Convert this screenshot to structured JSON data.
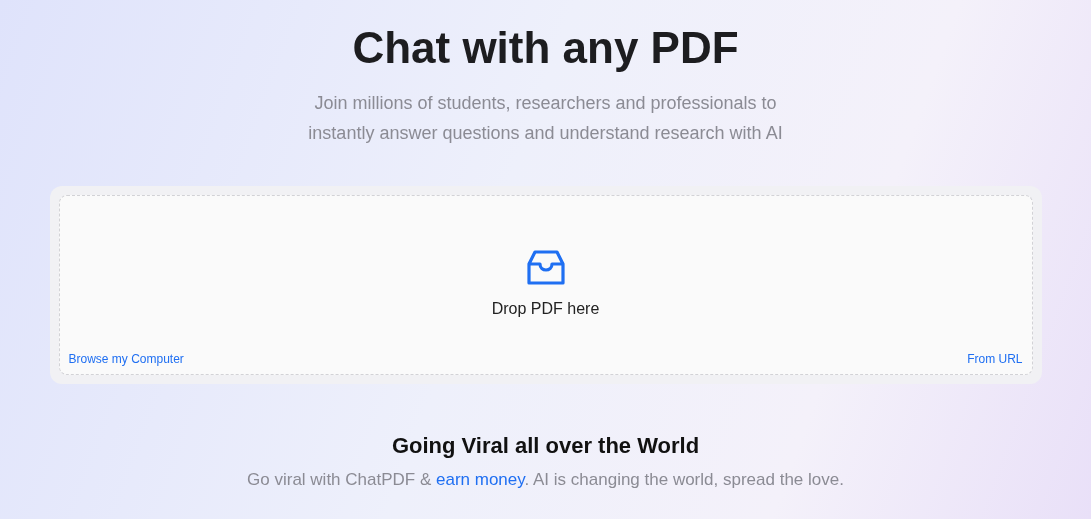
{
  "hero": {
    "title": "Chat with any PDF",
    "subtitle_lines": [
      "Join millions of students, researchers and professionals to",
      "instantly answer questions and understand research with AI"
    ]
  },
  "dropzone": {
    "label": "Drop PDF here",
    "browse_link": "Browse my Computer",
    "url_link": "From URL"
  },
  "viral": {
    "heading": "Going Viral all over the World",
    "text_before": "Go viral with ChatPDF & ",
    "link": "earn money",
    "text_after": ". AI is changing the world, spread the love."
  }
}
